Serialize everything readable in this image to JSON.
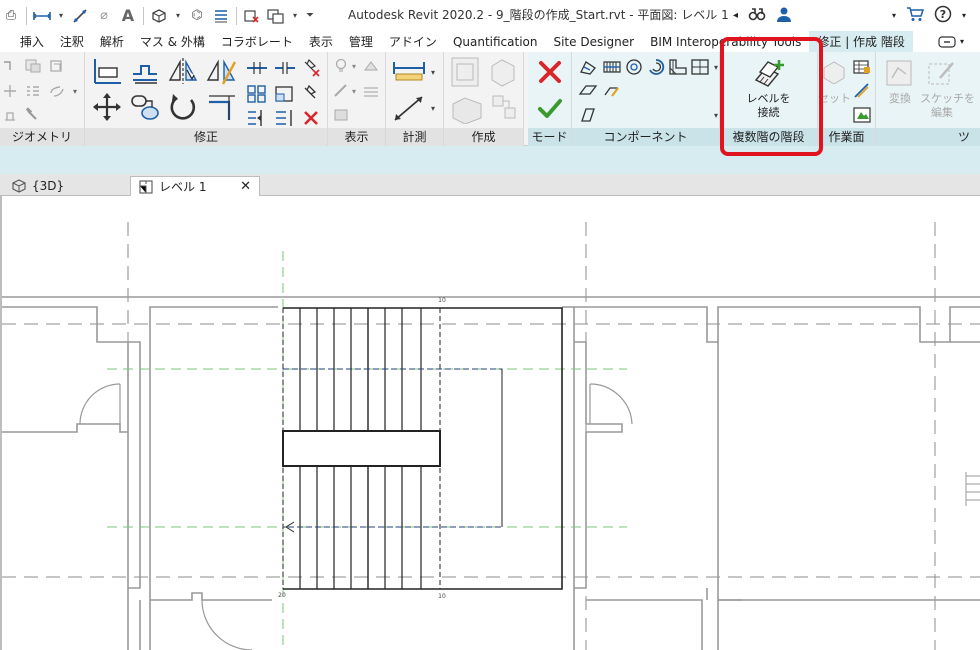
{
  "titlebar": {
    "title": "Autodesk Revit 2020.2 - 9_階段の作成_Start.rvt - 平面図: レベル 1"
  },
  "tabs": [
    {
      "label": "挿入"
    },
    {
      "label": "注釈"
    },
    {
      "label": "解析"
    },
    {
      "label": "マス & 外構"
    },
    {
      "label": "コラボレート"
    },
    {
      "label": "表示"
    },
    {
      "label": "管理"
    },
    {
      "label": "アドイン"
    },
    {
      "label": "Quantification"
    },
    {
      "label": "Site Designer"
    },
    {
      "label": "BIM Interoperability Tools"
    },
    {
      "label": "修正 | 作成 階段"
    }
  ],
  "ribbon": {
    "panels": {
      "geometry": "ジオメトリ",
      "modify": "修正",
      "view": "表示",
      "measure": "計測",
      "create": "作成",
      "mode": "モード",
      "components": "コンポーネント",
      "multistory": "複数階の階段",
      "workplane": "作業面",
      "tools": "ツール"
    },
    "connect_levels": {
      "line1": "レベルを",
      "line2": "接続"
    },
    "set_label": "セット",
    "convert_label": "変換",
    "edit_sketch": {
      "line1": "スケッチを",
      "line2": "編集"
    }
  },
  "views": {
    "tab_3d": "{3D}",
    "tab_level1": "レベル 1"
  },
  "drawing": {
    "run_up_number": "10",
    "run_down_number": "10",
    "start_number": "20"
  },
  "colors": {
    "highlight": "#e0141e",
    "contextual": "#d6ecf0",
    "ok_green": "#3a9a2e",
    "cancel_red": "#d9262b",
    "icon_blue": "#1f5fa8"
  }
}
